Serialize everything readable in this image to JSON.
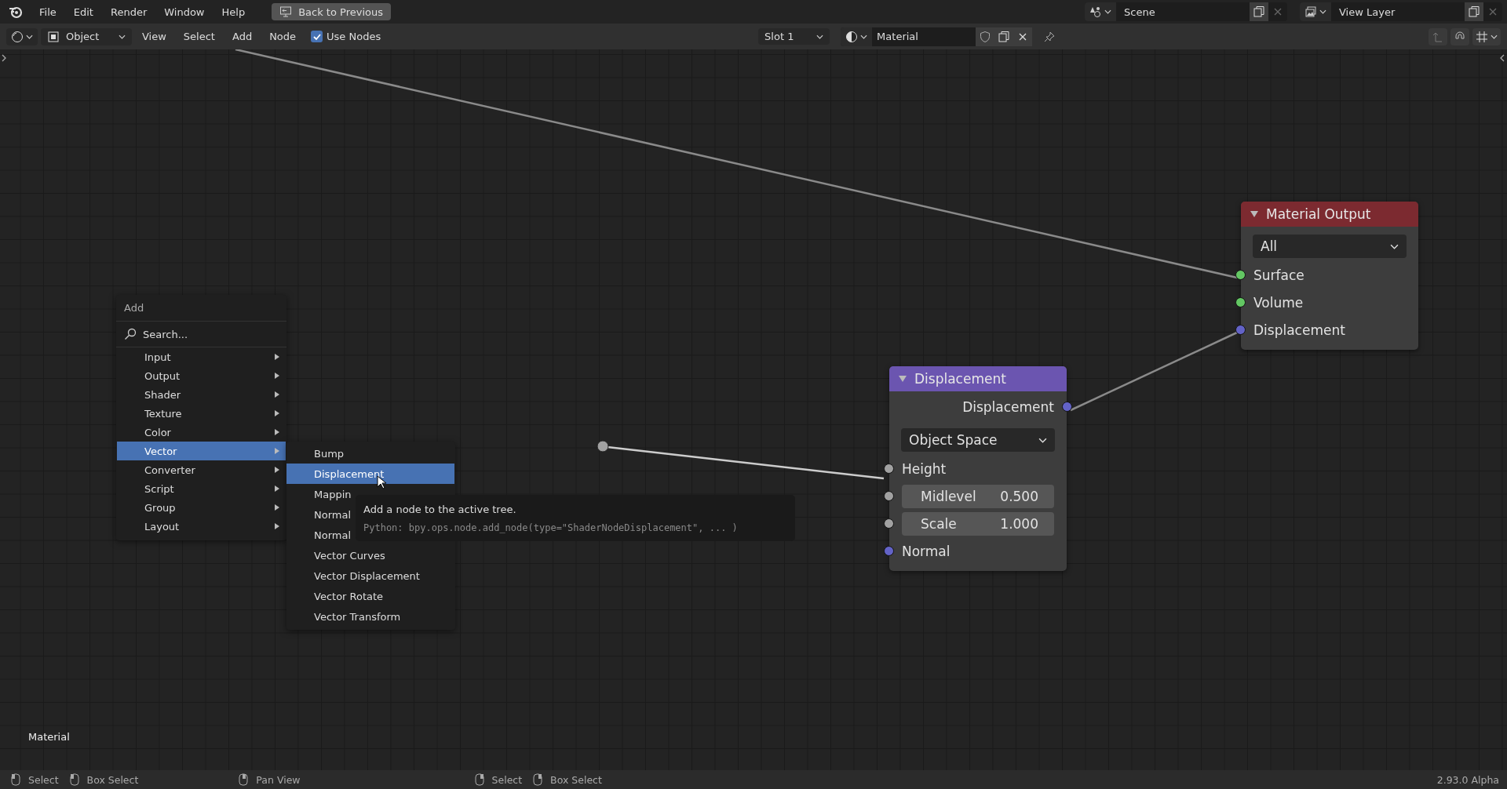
{
  "menubar": {
    "items": [
      "File",
      "Edit",
      "Render",
      "Window",
      "Help"
    ],
    "back_button": "Back to Previous",
    "scene": "Scene",
    "view_layer": "View Layer"
  },
  "header": {
    "mode": "Object",
    "menus": [
      "View",
      "Select",
      "Add",
      "Node"
    ],
    "use_nodes": {
      "label": "Use Nodes",
      "checked": true
    },
    "slot": "Slot 1",
    "material": "Material"
  },
  "canvas": {
    "label": "Material"
  },
  "nodes": [
    {
      "kind": "output",
      "title": "Material Output",
      "color": "#7c2a30",
      "dropdown": "All",
      "inputs": [
        {
          "label": "Surface",
          "color": "#63c763"
        },
        {
          "label": "Volume",
          "color": "#63c763"
        },
        {
          "label": "Displacement",
          "color": "#6363c7"
        }
      ]
    },
    {
      "kind": "displacement",
      "title": "Displacement",
      "color": "#6b55b0",
      "dropdown": "Object Space",
      "outputs": [
        {
          "label": "Displacement",
          "color": "#6363c7"
        }
      ],
      "inputs": [
        {
          "label": "Height",
          "color": "#a1a1a1"
        },
        {
          "label": "Midlevel",
          "value": "0.500",
          "color": "#a1a1a1"
        },
        {
          "label": "Scale",
          "value": "1.000",
          "color": "#a1a1a1"
        },
        {
          "label": "Normal",
          "color": "#6363c7"
        }
      ]
    }
  ],
  "add_menu": {
    "title": "Add",
    "search": "Search...",
    "items": [
      {
        "label": "Input",
        "selected": false
      },
      {
        "label": "Output",
        "selected": false
      },
      {
        "label": "Shader",
        "selected": false
      },
      {
        "label": "Texture",
        "selected": false
      },
      {
        "label": "Color",
        "selected": false
      },
      {
        "label": "Vector",
        "selected": true
      },
      {
        "label": "Converter",
        "selected": false
      },
      {
        "label": "Script",
        "selected": false
      },
      {
        "label": "Group",
        "selected": false
      },
      {
        "label": "Layout",
        "selected": false
      }
    ]
  },
  "submenu": {
    "items": [
      {
        "label": "Bump",
        "selected": false
      },
      {
        "label": "Displacement",
        "selected": true
      },
      {
        "label": "Mappin",
        "selected": false
      },
      {
        "label": "Normal",
        "selected": false
      },
      {
        "label": "Normal",
        "selected": false
      },
      {
        "label": "Vector Curves",
        "selected": false
      },
      {
        "label": "Vector Displacement",
        "selected": false
      },
      {
        "label": "Vector Rotate",
        "selected": false
      },
      {
        "label": "Vector Transform",
        "selected": false
      }
    ]
  },
  "tooltip": {
    "description": "Add a node to the active tree.",
    "python": "Python: bpy.ops.node.add_node(type=\"ShaderNodeDisplacement\", ... )"
  },
  "status_bar": {
    "left": [
      {
        "label": "Select"
      },
      {
        "label": "Box Select"
      },
      {
        "label": "Pan View"
      }
    ],
    "middle": [
      {
        "label": "Select"
      },
      {
        "label": "Box Select"
      }
    ],
    "version": "2.93.0 Alpha"
  }
}
